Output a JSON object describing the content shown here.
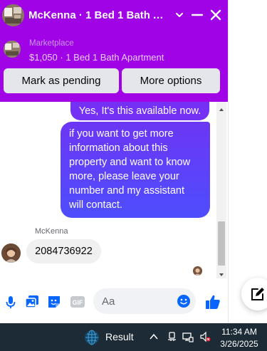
{
  "header": {
    "title": "McKenna · 1 Bed 1 Bath Ap...",
    "marketplace_label": "Marketplace",
    "listing_summary": "$1,050 · 1 Bed 1 Bath Apartment",
    "mark_pending_label": "Mark as pending",
    "more_options_label": "More options",
    "accent_color": "#a103e7"
  },
  "messages": {
    "outgoing_1": "Yes, It's this available now.",
    "outgoing_2": "if you want to get more information about this property and want to know more, please leave your number and my assistant will contact.",
    "sender_name": "McKenna",
    "incoming_1": "2084736922"
  },
  "composer": {
    "placeholder": "Aa",
    "gif_label": "GIF"
  },
  "taskbar": {
    "weather_label": "Result",
    "time": "11:34 AM",
    "date": "3/26/2025"
  },
  "icons": {
    "header": [
      "minimize-icon",
      "dash-icon",
      "close-icon"
    ],
    "composer": [
      "microphone-icon",
      "photo-icon",
      "sticker-icon",
      "gif-icon",
      "emoji-icon",
      "thumbs-up-icon"
    ],
    "floating": "compose-icon",
    "tray": [
      "chevron-up-icon",
      "network-icon",
      "wifi-icon",
      "volume-muted-icon"
    ]
  }
}
